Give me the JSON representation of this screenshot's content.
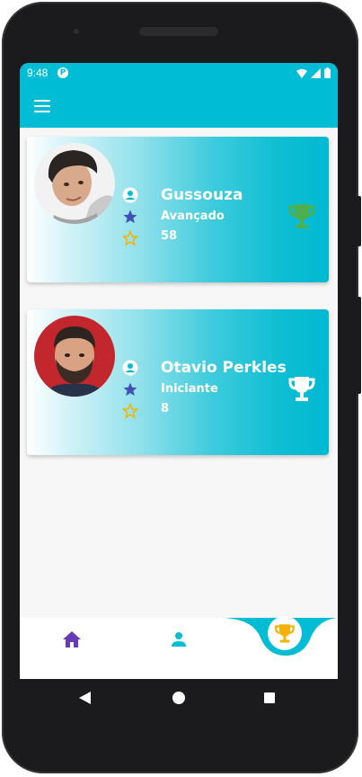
{
  "status_bar": {
    "time": "9:48",
    "app_badge": "P"
  },
  "app_bar": {
    "menu_icon": "hamburger-icon"
  },
  "colors": {
    "accent": "#00bcd4",
    "trophy_green": "#4caf50",
    "trophy_gold": "#f5b301",
    "nav_purple": "#673ab7"
  },
  "ranking": [
    {
      "name": "Gussouza",
      "level": "Avançado",
      "score": "58",
      "trophy": "green"
    },
    {
      "name": "Otavio Perkles",
      "level": "Iniciante",
      "score": "8",
      "trophy": "white"
    }
  ],
  "bottom_nav": {
    "items": [
      {
        "icon": "home-icon",
        "active": false
      },
      {
        "icon": "person-icon",
        "active": false
      },
      {
        "icon": "trophy-icon",
        "active": true
      }
    ]
  }
}
